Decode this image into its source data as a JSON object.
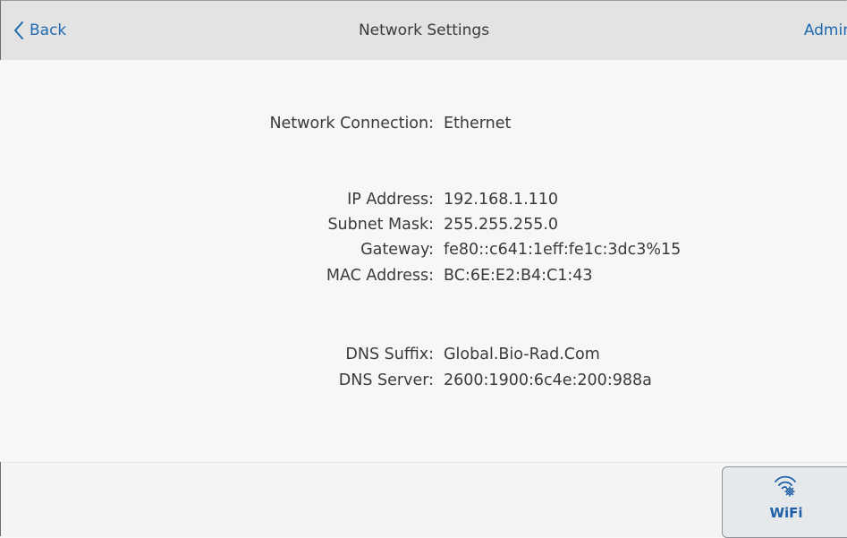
{
  "header": {
    "back_label": "Back",
    "title": "Network Settings",
    "admin_label": "Admin"
  },
  "network": {
    "connection": {
      "label": "Network Connection:",
      "value": "Ethernet"
    },
    "ip": {
      "label": "IP Address:",
      "value": "192.168.1.110"
    },
    "subnet": {
      "label": "Subnet Mask:",
      "value": "255.255.255.0"
    },
    "gateway": {
      "label": "Gateway:",
      "value": "fe80::c641:1eff:fe1c:3dc3%15"
    },
    "mac": {
      "label": "MAC Address:",
      "value": "BC:6E:E2:B4:C1:43"
    },
    "dns_suffix": {
      "label": "DNS Suffix:",
      "value": "Global.Bio-Rad.Com"
    },
    "dns_server": {
      "label": "DNS Server:",
      "value": "2600:1900:6c4e:200:988a"
    }
  },
  "footer": {
    "wifi_label": "WiFi",
    "wifi_icon": "wifi-gear-icon"
  },
  "colors": {
    "accent": "#1f6ab1",
    "header_bg": "#e3e3e3",
    "body_bg": "#f7f7f7",
    "text": "#3a3a3a"
  }
}
